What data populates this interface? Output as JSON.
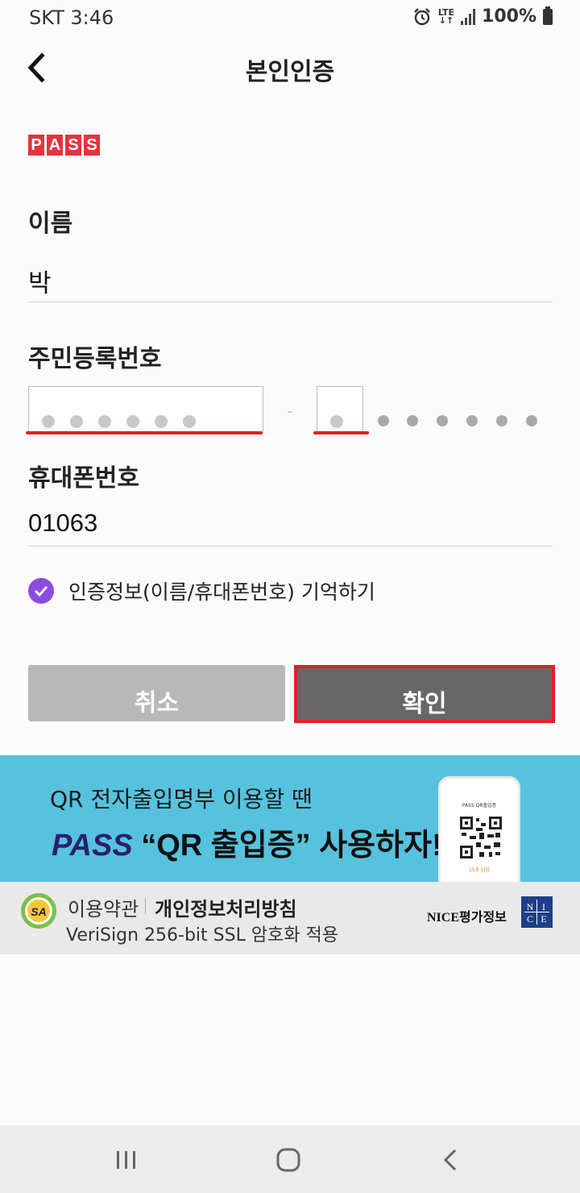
{
  "status_bar": {
    "carrier_time": "SKT 3:46",
    "network": "LTE",
    "battery": "100%"
  },
  "header": {
    "title": "본인인증"
  },
  "brand": {
    "letters": [
      "P",
      "A",
      "S",
      "S"
    ],
    "color": "#e8323c"
  },
  "form": {
    "name_label": "이름",
    "name_value": "박",
    "rrn_label": "주민등록번호",
    "rrn_separator": "-",
    "phone_label": "휴대폰번호",
    "phone_value": "01063",
    "remember_label": "인증정보(이름/휴대폰번호) 기억하기",
    "remember_checked": true
  },
  "buttons": {
    "cancel": "취소",
    "confirm": "확인"
  },
  "banner": {
    "line1": "QR 전자출입명부 이용할 땐",
    "line2_brand": "PASS",
    "line2_rest": " “QR 출입증” 사용하자!",
    "phone_title": "PASS QR출입증",
    "phone_footer": "15초 남음",
    "background": "#57c2dd"
  },
  "footer": {
    "terms": "이용약관",
    "privacy": "개인정보처리방침",
    "ssl": "VeriSign 256-bit SSL 암호화 적용",
    "nice": "NICE평가정보",
    "nice_logo_letters": [
      "N",
      "I",
      "C",
      "E"
    ]
  },
  "icons": {
    "back": "chevron-left-icon",
    "check": "check-circle-icon",
    "alarm": "alarm-icon",
    "signal": "signal-icon",
    "battery": "battery-icon"
  },
  "colors": {
    "accent_red": "#e0202a",
    "check_purple": "#8a4dde",
    "cancel_gray": "#b8b8b8",
    "confirm_gray": "#676767"
  }
}
